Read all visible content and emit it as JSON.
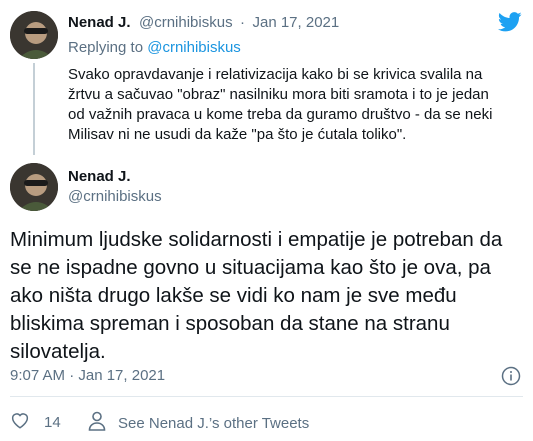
{
  "reply_tweet": {
    "author_name": "Nenad J.",
    "author_handle": "@crnihibiskus",
    "separator": "·",
    "date": "Jan 17, 2021",
    "replying_to_label": "Replying to",
    "replying_to_handle": "@crnihibiskus",
    "text": "Svako opravdavanje i relativizacija kako bi se krivica svalila na žrtvu a sačuvao \"obraz\" nasilniku mora biti sramota i to je jedan od važnih pravaca u kome treba da guramo društvo - da se neki Milisav ni ne usudi da kaže \"pa što je ćutala toliko\"."
  },
  "main_tweet": {
    "author_name": "Nenad J.",
    "author_handle": "@crnihibiskus",
    "text": "Minimum ljudske solidarnosti i empatije je potreban da se ne ispadne govno u situacijama kao što je ova, pa ako ništa drugo lakše se vidi ko nam je sve među bliskima spreman i sposoban da stane na stranu silovatelja.",
    "timestamp": "9:07 AM · Jan 17, 2021"
  },
  "actions": {
    "like_count": "14",
    "other_tweets_label": "See Nenad J.’s other Tweets"
  },
  "icons": {
    "logo": "twitter-bird-icon",
    "info": "info-icon",
    "like": "heart-icon",
    "profile": "person-icon"
  },
  "colors": {
    "twitter_blue": "#1da1f2",
    "link_blue": "#1b95e0",
    "muted": "#5b7083",
    "text": "#0f1419"
  }
}
